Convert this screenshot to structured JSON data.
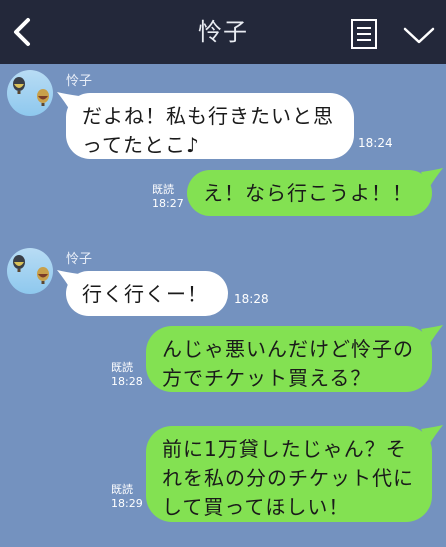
{
  "header": {
    "title": "怜子",
    "icons": {
      "back": "chevron-left-icon",
      "menu": "notes-icon",
      "collapse": "chevron-down-icon"
    }
  },
  "colors": {
    "header": "#23283a",
    "background": "#7492bf",
    "incoming": "#ffffff",
    "outgoing": "#83e152"
  },
  "messages": [
    {
      "side": "in",
      "sender": "怜子",
      "lines": [
        "だよね！私も行きたいと思",
        "ってたとこ♪"
      ],
      "time": "18:24"
    },
    {
      "side": "out",
      "lines": [
        "え！なら行こうよ！！"
      ],
      "read": "既読",
      "time": "18:27"
    },
    {
      "side": "in",
      "sender": "怜子",
      "lines": [
        "行く行くー！"
      ],
      "time": "18:28"
    },
    {
      "side": "out",
      "lines": [
        "んじゃ悪いんだけど怜子の",
        "方でチケット買える？"
      ],
      "read": "既読",
      "time": "18:28"
    },
    {
      "side": "out",
      "lines": [
        "前に1万貸したじゃん？そ",
        "れを私の分のチケット代に",
        "して買ってほしい！"
      ],
      "read": "既読",
      "time": "18:29"
    }
  ]
}
